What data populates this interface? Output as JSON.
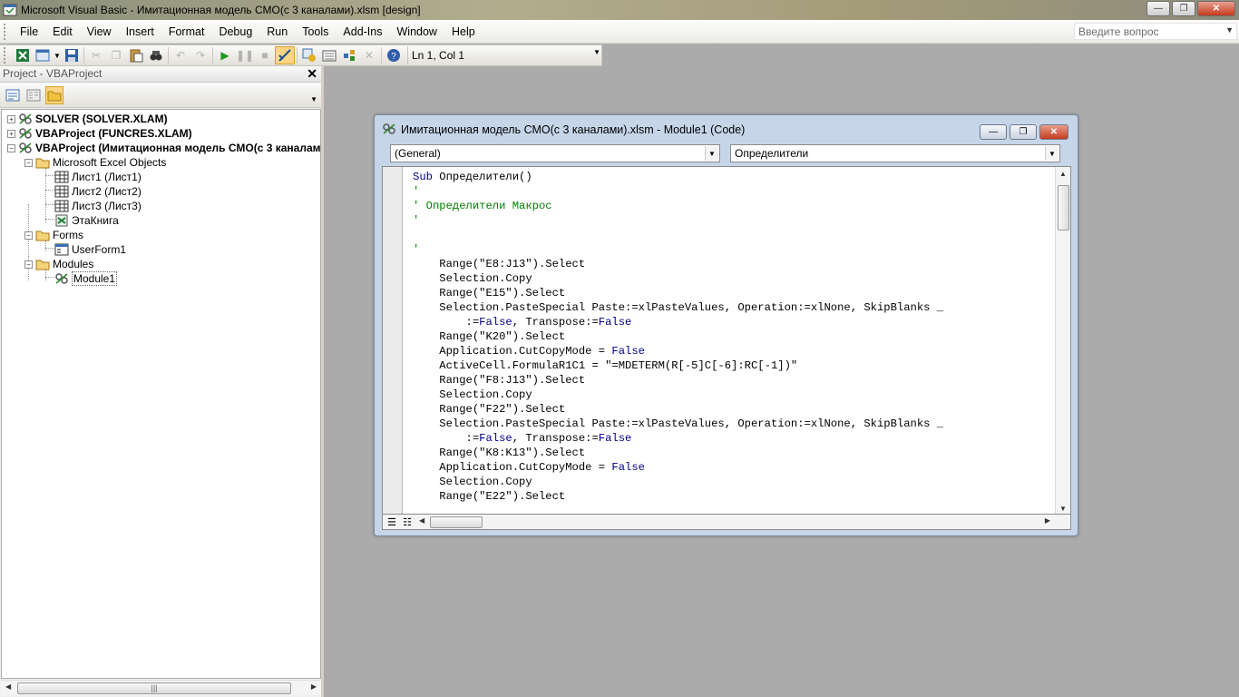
{
  "window": {
    "title": "Microsoft Visual Basic - Имитационная модель СМО(с 3 каналами).xlsm [design]",
    "buttons": {
      "minimize": "—",
      "restore": "❐",
      "close": "✕"
    }
  },
  "menubar": {
    "items": [
      "File",
      "Edit",
      "View",
      "Insert",
      "Format",
      "Debug",
      "Run",
      "Tools",
      "Add-Ins",
      "Window",
      "Help"
    ],
    "ask_placeholder": "Введите вопрос"
  },
  "toolbar": {
    "position_text": "Ln 1, Col 1"
  },
  "project": {
    "title": "Project - VBAProject",
    "nodes": {
      "solver": "SOLVER (SOLVER.XLAM)",
      "funcres": "VBAProject (FUNCRES.XLAM)",
      "vbaproject": "VBAProject (Имитационная модель СМО(с 3 каналами",
      "excel_objects": "Microsoft Excel Objects",
      "sheet1": "Лист1 (Лист1)",
      "sheet2": "Лист2 (Лист2)",
      "sheet3": "Лист3 (Лист3)",
      "thisworkbook": "ЭтаКнига",
      "forms": "Forms",
      "userform1": "UserForm1",
      "modules": "Modules",
      "module1": "Module1"
    }
  },
  "codewindow": {
    "title": "Имитационная модель СМО(с 3 каналами).xlsm - Module1 (Code)",
    "object_combo": "(General)",
    "procedure_combo": "Определители",
    "lines": [
      [
        {
          "t": "Sub ",
          "c": "kw"
        },
        {
          "t": "Определители()",
          "c": ""
        }
      ],
      [
        {
          "t": "'",
          "c": "cm"
        }
      ],
      [
        {
          "t": "' Определители Макрос",
          "c": "cm"
        }
      ],
      [
        {
          "t": "'",
          "c": "cm"
        }
      ],
      [
        {
          "t": "",
          "c": ""
        }
      ],
      [
        {
          "t": "'",
          "c": "cm"
        }
      ],
      [
        {
          "t": "    Range(\"E8:J13\").Select",
          "c": ""
        }
      ],
      [
        {
          "t": "    Selection.Copy",
          "c": ""
        }
      ],
      [
        {
          "t": "    Range(\"E15\").Select",
          "c": ""
        }
      ],
      [
        {
          "t": "    Selection.PasteSpecial Paste:=xlPasteValues, Operation:=xlNone, SkipBlanks _",
          "c": ""
        }
      ],
      [
        {
          "t": "        :=",
          "c": ""
        },
        {
          "t": "False",
          "c": "kw"
        },
        {
          "t": ", Transpose:=",
          "c": ""
        },
        {
          "t": "False",
          "c": "kw"
        }
      ],
      [
        {
          "t": "    Range(\"K20\").Select",
          "c": ""
        }
      ],
      [
        {
          "t": "    Application.CutCopyMode = ",
          "c": ""
        },
        {
          "t": "False",
          "c": "kw"
        }
      ],
      [
        {
          "t": "    ActiveCell.FormulaR1C1 = \"=MDETERM(R[-5]C[-6]:RC[-1])\"",
          "c": ""
        }
      ],
      [
        {
          "t": "    Range(\"F8:J13\").Select",
          "c": ""
        }
      ],
      [
        {
          "t": "    Selection.Copy",
          "c": ""
        }
      ],
      [
        {
          "t": "    Range(\"F22\").Select",
          "c": ""
        }
      ],
      [
        {
          "t": "    Selection.PasteSpecial Paste:=xlPasteValues, Operation:=xlNone, SkipBlanks _",
          "c": ""
        }
      ],
      [
        {
          "t": "        :=",
          "c": ""
        },
        {
          "t": "False",
          "c": "kw"
        },
        {
          "t": ", Transpose:=",
          "c": ""
        },
        {
          "t": "False",
          "c": "kw"
        }
      ],
      [
        {
          "t": "    Range(\"K8:K13\").Select",
          "c": ""
        }
      ],
      [
        {
          "t": "    Application.CutCopyMode = ",
          "c": ""
        },
        {
          "t": "False",
          "c": "kw"
        }
      ],
      [
        {
          "t": "    Selection.Copy",
          "c": ""
        }
      ],
      [
        {
          "t": "    Range(\"E22\").Select",
          "c": ""
        }
      ]
    ]
  }
}
